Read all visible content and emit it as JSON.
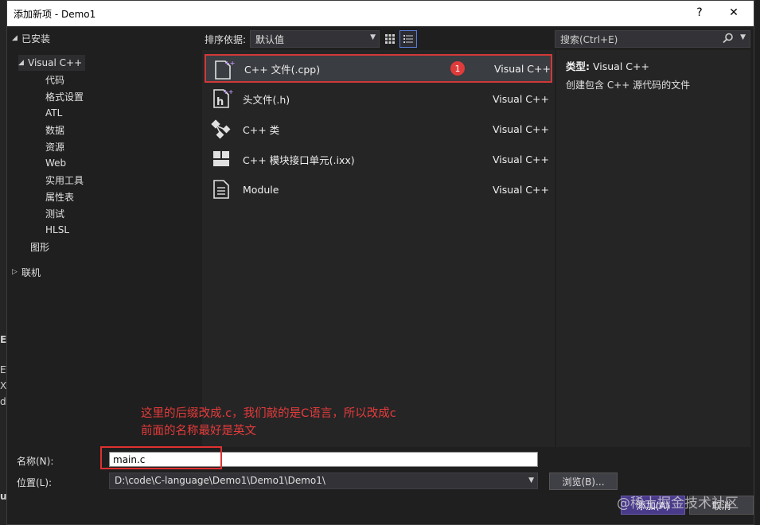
{
  "dialog": {
    "title": "添加新项 - Demo1",
    "help_glyph": "?",
    "close_glyph": "✕"
  },
  "tree": {
    "installed": "已安装",
    "visual_cpp": "Visual C++",
    "children": [
      "代码",
      "格式设置",
      "ATL",
      "数据",
      "资源",
      "Web",
      "实用工具",
      "属性表",
      "测试",
      "HLSL"
    ],
    "graphics": "图形",
    "online": "联机"
  },
  "toolbar": {
    "sort_label": "排序依据:",
    "sort_value": "默认值"
  },
  "search": {
    "placeholder": "搜索(Ctrl+E)"
  },
  "items": [
    {
      "name": "C++ 文件(.cpp)",
      "type": "Visual C++",
      "icon": "cpp-file-icon",
      "selected": true,
      "badge": "1"
    },
    {
      "name": "头文件(.h)",
      "type": "Visual C++",
      "icon": "header-file-icon"
    },
    {
      "name": "C++ 类",
      "type": "Visual C++",
      "icon": "class-icon"
    },
    {
      "name": "C++ 模块接口单元(.ixx)",
      "type": "Visual C++",
      "icon": "module-interface-icon"
    },
    {
      "name": "Module",
      "type": "Visual C++",
      "icon": "module-icon"
    }
  ],
  "details": {
    "type_label": "类型:",
    "type_value": "Visual C++",
    "description": "创建包含 C++ 源代码的文件"
  },
  "annotation": {
    "line1": "这里的后缀改成.c，我们敲的是C语言，所以改成c",
    "line2": "前面的名称最好是英文"
  },
  "form": {
    "name_label": "名称(N):",
    "name_value": "main.c",
    "location_label": "位置(L):",
    "location_value": "D:\\code\\C-language\\Demo1\\Demo1\\Demo1\\",
    "browse_label": "浏览(B)...",
    "add_label": "添加(A)",
    "cancel_label": "取消"
  },
  "watermark": "@稀土掘金技术社区",
  "background_fragments": [
    "E",
    "ET",
    "XA",
    "d",
    "u"
  ],
  "colors": {
    "accent_red": "#e03b3b",
    "add_button": "#4a3a8a"
  }
}
